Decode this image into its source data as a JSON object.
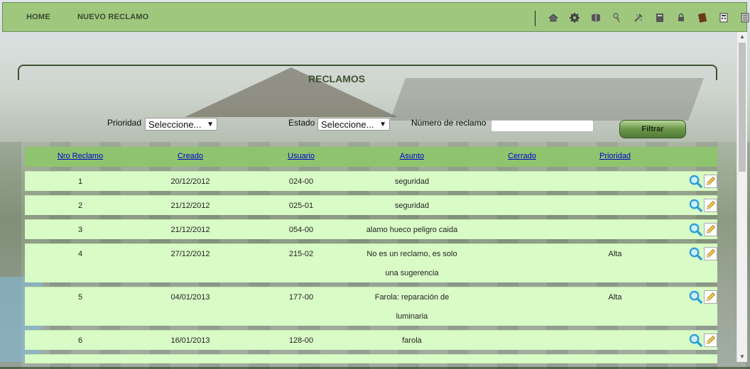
{
  "nav": {
    "home": "HOME",
    "new_claim": "NUEVO RECLAMO"
  },
  "toolbar_icons": [
    "home-icon",
    "gear-icon",
    "book-icon",
    "key-icon",
    "tools-icon",
    "notebook-icon",
    "lock-icon",
    "brown-book-icon",
    "calculator-icon",
    "document-icon"
  ],
  "page": {
    "title": "RECLAMOS"
  },
  "filters": {
    "priority_label": "Prioridad",
    "priority_value": "Seleccione...",
    "state_label": "Estado",
    "state_value": "Seleccione...",
    "number_label": "Número de reclamo",
    "number_value": "",
    "filter_button": "Filtrar"
  },
  "table": {
    "headers": [
      "Nro Reclamo",
      "Creado",
      "Usuario",
      "Asunto",
      "Cerrado",
      "Prioridad"
    ],
    "rows": [
      {
        "nro": "1",
        "creado": "20/12/2012",
        "usuario": "024-00",
        "asunto1": "seguridad",
        "asunto2": "",
        "cerrado": "",
        "prioridad": ""
      },
      {
        "nro": "2",
        "creado": "21/12/2012",
        "usuario": "025-01",
        "asunto1": "seguridad",
        "asunto2": "",
        "cerrado": "",
        "prioridad": ""
      },
      {
        "nro": "3",
        "creado": "21/12/2012",
        "usuario": "054-00",
        "asunto1": "alamo hueco peligro caida",
        "asunto2": "",
        "cerrado": "",
        "prioridad": ""
      },
      {
        "nro": "4",
        "creado": "27/12/2012",
        "usuario": "215-02",
        "asunto1": "No es un reclamo, es solo",
        "asunto2": "una sugerencia",
        "cerrado": "",
        "prioridad": "Alta"
      },
      {
        "nro": "5",
        "creado": "04/01/2013",
        "usuario": "177-00",
        "asunto1": "Farola: reparación de",
        "asunto2": "luminaria",
        "cerrado": "",
        "prioridad": "Alta"
      },
      {
        "nro": "6",
        "creado": "16/01/2013",
        "usuario": "128-00",
        "asunto1": "farola",
        "asunto2": "",
        "cerrado": "",
        "prioridad": ""
      }
    ]
  },
  "colors": {
    "header_green": "#9fc87e",
    "table_header": "#8fc46e",
    "row_bg": "#d9fbc6",
    "link_blue": "#0000cc"
  }
}
